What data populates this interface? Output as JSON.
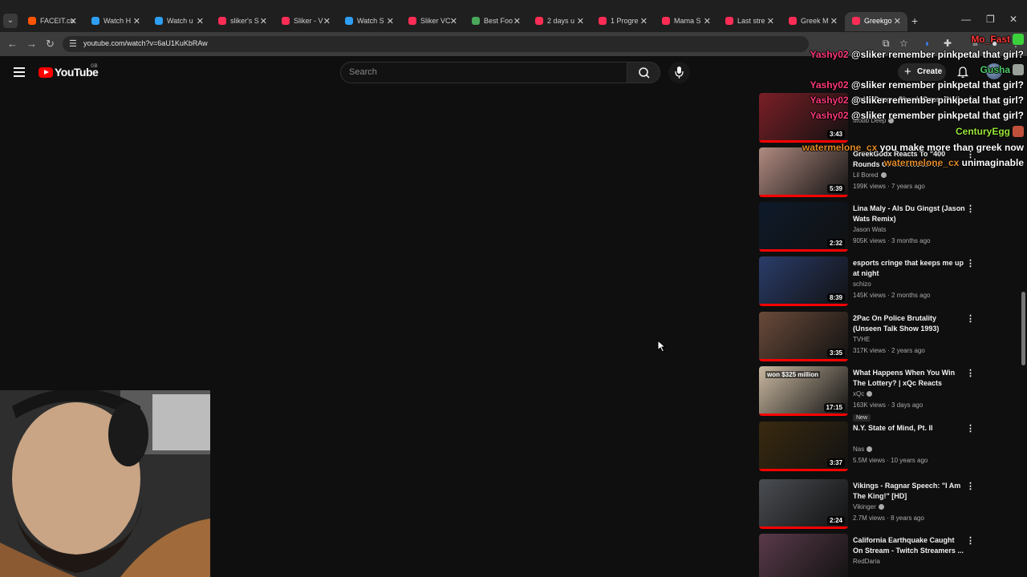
{
  "browser": {
    "tabs": [
      {
        "title": "FACEIT.co",
        "fav_color": "#ff5500"
      },
      {
        "title": "Watch H",
        "fav_color": "#2e9ff5"
      },
      {
        "title": "Watch u",
        "fav_color": "#2e9ff5"
      },
      {
        "title": "sliker's S",
        "fav_color": "#ff2d55"
      },
      {
        "title": "Sliker - V",
        "fav_color": "#ff2d55"
      },
      {
        "title": "Watch S",
        "fav_color": "#2e9ff5"
      },
      {
        "title": "Sliker VC",
        "fav_color": "#ff2d55"
      },
      {
        "title": "Best Foo",
        "fav_color": "#49a65a"
      },
      {
        "title": "2 days u",
        "fav_color": "#ff2d55"
      },
      {
        "title": "1 Progre",
        "fav_color": "#ff2d55"
      },
      {
        "title": "Mama S",
        "fav_color": "#ff2d55"
      },
      {
        "title": "Last stre",
        "fav_color": "#ff2d55"
      },
      {
        "title": "Greek M",
        "fav_color": "#ff2d55"
      },
      {
        "title": "Greekgo",
        "fav_color": "#ff2d55"
      }
    ],
    "active_tab_index": 13,
    "url": "youtube.com/watch?v=6aU1KuKbRAw"
  },
  "youtube": {
    "logo_text": "YouTube",
    "country_code": "GB",
    "search_placeholder": "Search",
    "create_label": "Create"
  },
  "recommendations": [
    {
      "title": "Mobb Deep - Shook Ones, Pt. II",
      "channel": "Mobb Deep",
      "verified": true,
      "meta": "",
      "duration": "3:43",
      "thumb": "#7a1f26"
    },
    {
      "title": "GreekGodx Reacts To \"400 Rounds Of Basketball\" ...",
      "channel": "Lil Bored",
      "verified": true,
      "meta": "199K views · 7 years ago",
      "duration": "5:39",
      "thumb": "#b08a80"
    },
    {
      "title": "Lina Maly - Als Du Gingst (Jason Wats Remix)",
      "channel": "Jason Wats",
      "verified": false,
      "meta": "905K views · 3 months ago",
      "duration": "2:32",
      "thumb": "#0e1a2a"
    },
    {
      "title": "esports cringe that keeps me up at night",
      "channel": "schizo",
      "verified": false,
      "meta": "145K views · 2 months ago",
      "duration": "8:39",
      "thumb": "#2a3c6a"
    },
    {
      "title": "2Pac On Police Brutality (Unseen Talk Show 1993)",
      "channel": "TVHE",
      "verified": false,
      "meta": "317K views · 2 years ago",
      "duration": "3:35",
      "thumb": "#6a4a3a"
    },
    {
      "title": "What Happens When You Win The Lottery? | xQc Reacts",
      "channel": "xQc",
      "verified": true,
      "meta": "163K views · 3 days ago",
      "duration": "17:15",
      "thumb": "#c9b8a0",
      "badge": "New",
      "thumb_text": "won $325 million"
    },
    {
      "title": "N.Y. State of Mind, Pt. II",
      "channel": "Nas",
      "verified": true,
      "meta": "5.5M views · 10 years ago",
      "duration": "3:37",
      "thumb": "#3a2a10"
    },
    {
      "title": "Vikings - Ragnar Speech: \"I Am The King!\" [HD]",
      "channel": "Vikinger",
      "verified": true,
      "meta": "2.7M views · 8 years ago",
      "duration": "2:24",
      "thumb": "#4a4d52"
    },
    {
      "title": "California Earthquake Caught On Stream - Twitch Streamers ...",
      "channel": "RedDaria",
      "verified": false,
      "meta": "",
      "duration": "",
      "thumb": "#5a3a4a"
    }
  ],
  "chat": [
    {
      "user": "Mo_Fast",
      "user_color": "#ff3b3b",
      "msg": "",
      "emote_color": "#3bd13b"
    },
    {
      "user": "Yashy02",
      "user_color": "#ff3b7a",
      "msg": "@sliker remember pinkpetal that girl?"
    },
    {
      "user": "Gusha",
      "user_color": "#4ecb6a",
      "msg": "",
      "emote_color": "#9aa09a"
    },
    {
      "user": "Yashy02",
      "user_color": "#ff3b7a",
      "msg": "@sliker remember pinkpetal that girl?"
    },
    {
      "user": "Yashy02",
      "user_color": "#ff3b7a",
      "msg": "@sliker remember pinkpetal that girl?"
    },
    {
      "user": "Yashy02",
      "user_color": "#ff3b7a",
      "msg": "@sliker remember pinkpetal that girl?"
    },
    {
      "user": "CenturyEgg",
      "user_color": "#9ae63b",
      "msg": "",
      "emote_color": "#c0503a"
    },
    {
      "user": "watermelone_cx",
      "user_color": "#e08a2a",
      "msg": "you make more than greek now"
    },
    {
      "user": "watermelone_cx",
      "user_color": "#e08a2a",
      "msg": "unimaginable"
    }
  ]
}
